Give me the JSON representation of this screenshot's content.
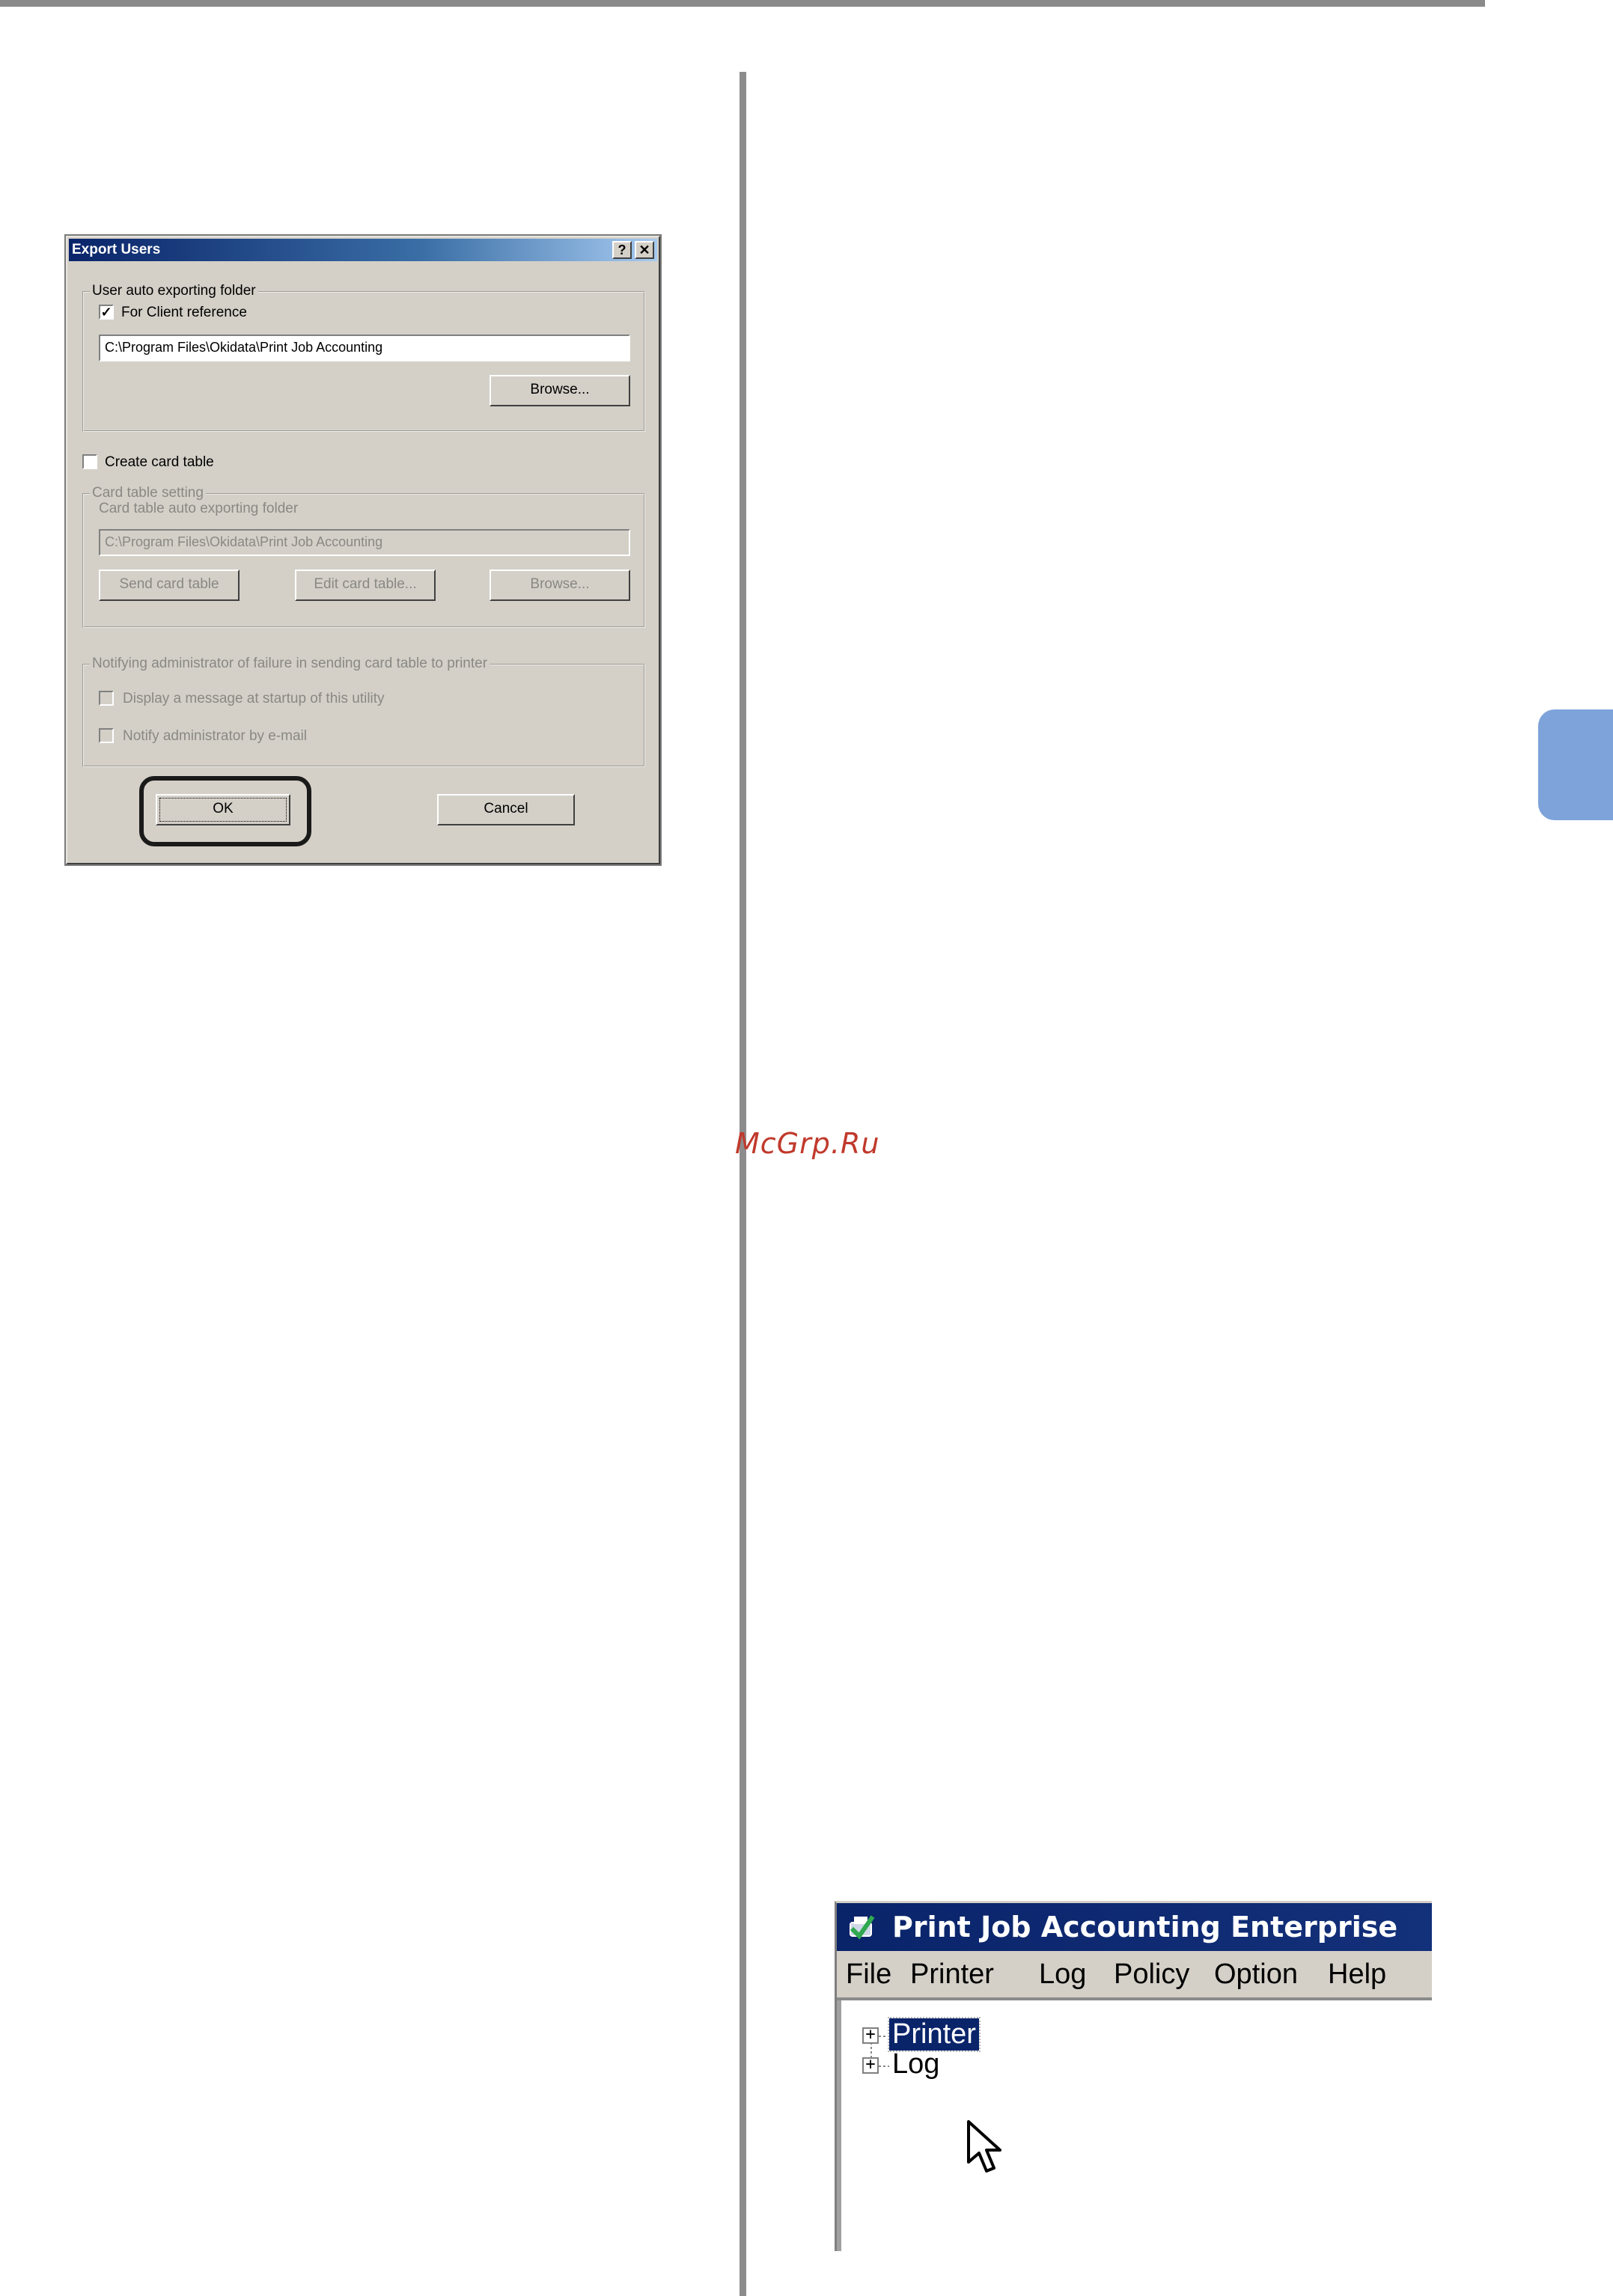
{
  "export_dialog": {
    "title": "Export Users",
    "help_button": "?",
    "close_button": "✕",
    "user_export_group": {
      "legend": "User auto exporting folder",
      "client_reference_label": "For Client reference",
      "client_reference_checked": true,
      "folder_value": "C:\\Program Files\\Okidata\\Print Job Accounting",
      "browse_label": "Browse..."
    },
    "create_card_table_label": "Create card table",
    "create_card_table_checked": false,
    "card_table_group": {
      "legend": "Card table setting",
      "folder_label": "Card table auto exporting folder",
      "folder_value": "C:\\Program Files\\Okidata\\Print Job Accounting",
      "send_label": "Send card table",
      "edit_label": "Edit card table...",
      "browse_label": "Browse..."
    },
    "notify_group": {
      "legend": "Notifying administrator of failure in sending card table to printer",
      "display_message_label": "Display a message at startup of this utility",
      "notify_email_label": "Notify administrator by e-mail"
    },
    "ok_label": "OK",
    "cancel_label": "Cancel"
  },
  "app_window": {
    "title": "Print Job Accounting Enterprise",
    "menu": [
      "File",
      "Printer",
      "Log",
      "Policy",
      "Option",
      "Help"
    ],
    "tree": [
      {
        "label": "Printer",
        "expander": "+"
      },
      {
        "label": "Log",
        "expander": "+"
      }
    ]
  },
  "watermark": "McGrp.Ru",
  "colors": {
    "tab_accent": "#7ea3da",
    "title_bar": "#0a246a",
    "dialog_face": "#d4d0c8"
  }
}
